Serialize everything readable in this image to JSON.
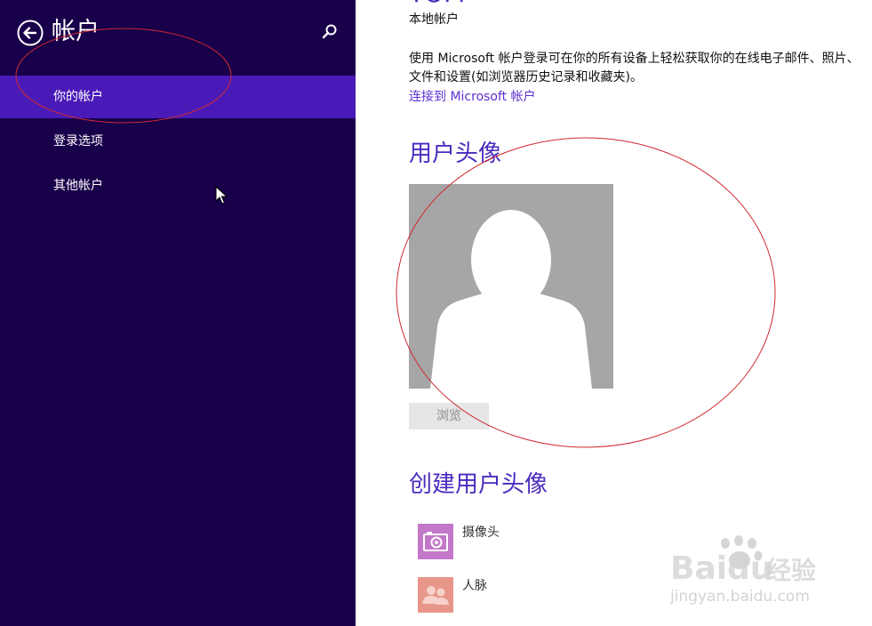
{
  "sidebar": {
    "title": "帐户",
    "back_icon": "back-arrow-icon",
    "search_icon": "search-icon",
    "items": [
      {
        "label": "你的帐户",
        "selected": true
      },
      {
        "label": "登录选项",
        "selected": false
      },
      {
        "label": "其他帐户",
        "selected": false
      }
    ]
  },
  "account": {
    "name": "TOM",
    "type": "本地帐户",
    "description": "使用 Microsoft 帐户登录可在你的所有设备上轻松获取你的在线电子邮件、照片、文件和设置(如浏览器历史记录和收藏夹)。",
    "link": "连接到 Microsoft 帐户"
  },
  "avatar_section": {
    "heading": "用户头像",
    "browse_label": "浏览"
  },
  "create_section": {
    "heading": "创建用户头像",
    "options": [
      {
        "label": "摄像头",
        "icon": "camera-icon",
        "color": "#c377c9"
      },
      {
        "label": "人脉",
        "icon": "people-icon",
        "color": "#e8968a"
      }
    ]
  },
  "watermark": {
    "brand": "Baidu",
    "suffix": "经验",
    "url": "jingyan.baidu.com"
  },
  "colors": {
    "sidebar_bg": "#18004a",
    "selected_bg": "#4a1ab8",
    "accent": "#4b2bbf",
    "annotation": "#d0282e"
  }
}
